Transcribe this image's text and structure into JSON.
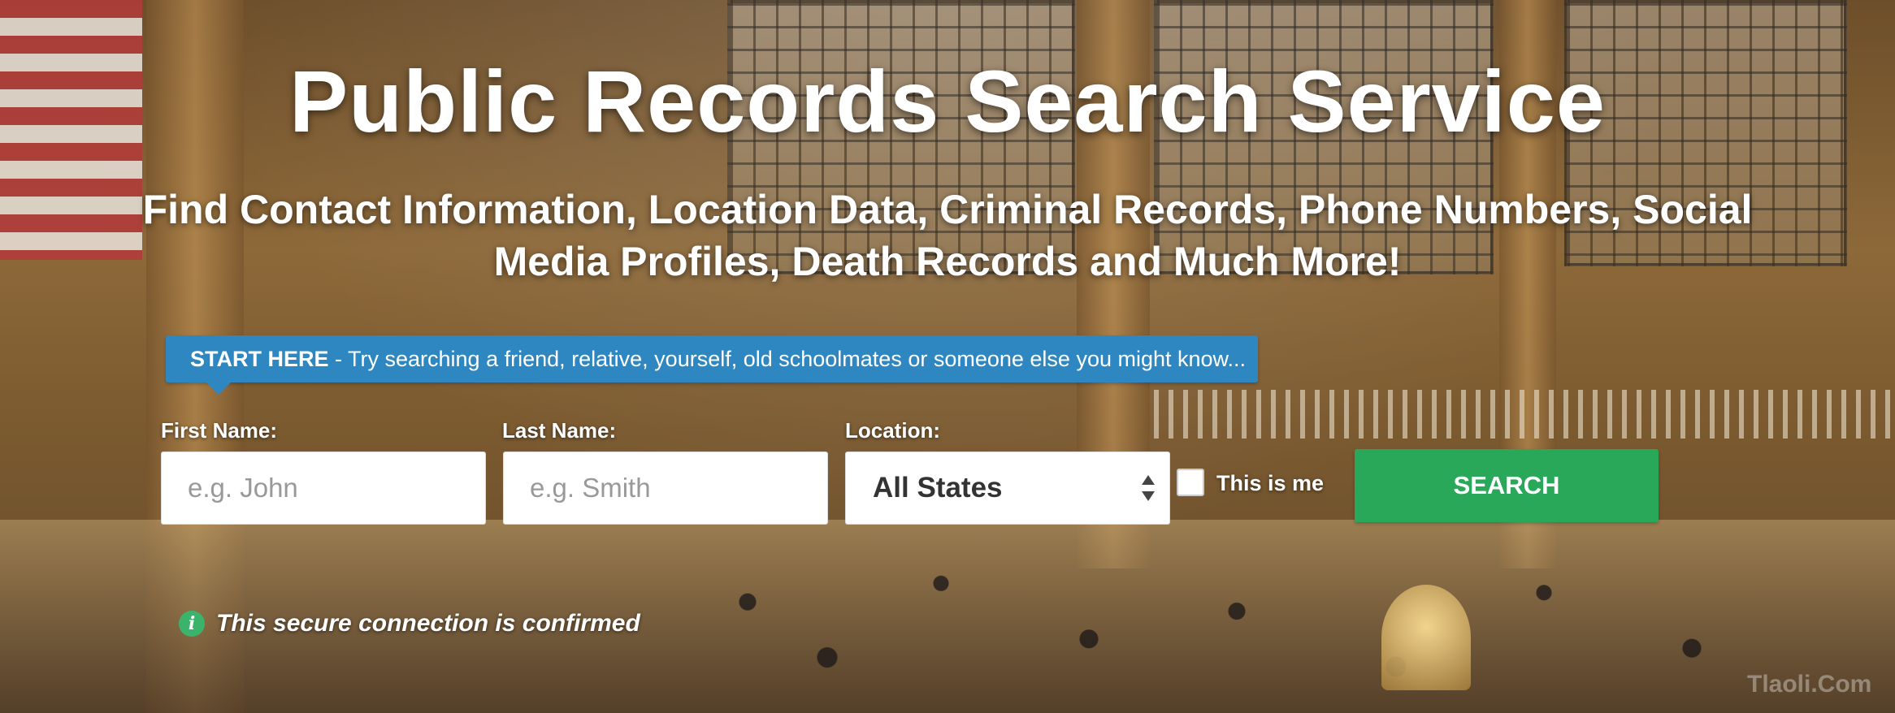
{
  "hero": {
    "title": "Public Records Search Service",
    "subtitle": "Find Contact Information, Location Data, Criminal Records, Phone Numbers, Social Media Profiles, Death Records and Much More!"
  },
  "banner": {
    "lead": "START HERE",
    "text": " - Try searching a friend, relative, yourself, old schoolmates or someone else you might know..."
  },
  "form": {
    "first_name_label": "First Name:",
    "first_name_placeholder": "e.g. John",
    "first_name_value": "",
    "last_name_label": "Last Name:",
    "last_name_placeholder": "e.g. Smith",
    "last_name_value": "",
    "location_label": "Location:",
    "location_selected": "All States",
    "this_is_me_label": "This is me",
    "this_is_me_checked": false,
    "search_button": "SEARCH"
  },
  "secure": {
    "icon": "info-icon",
    "icon_glyph": "i",
    "text": "This secure connection is confirmed"
  },
  "watermark": "Tlaoli.Com",
  "colors": {
    "banner": "#2e87c0",
    "search_button": "#2aa85a",
    "info_icon": "#3bb36b",
    "text": "#ffffff"
  }
}
